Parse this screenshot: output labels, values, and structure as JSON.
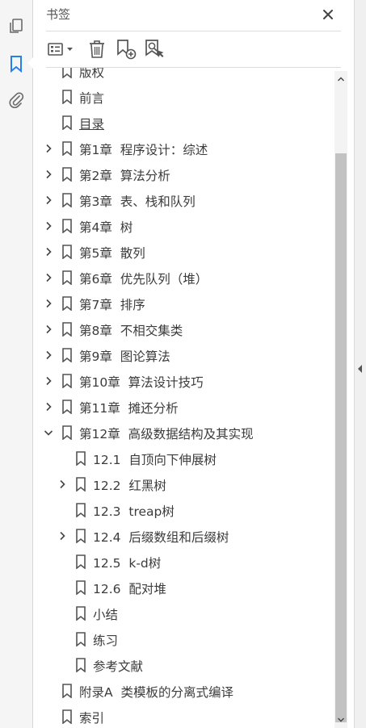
{
  "panel": {
    "title": "书签"
  },
  "rail": {
    "items": [
      "pages-icon",
      "bookmark-icon",
      "attachment-icon"
    ],
    "active": "bookmark-icon",
    "accent": "#2680eb"
  },
  "toolbar": {
    "icons": [
      "options-menu-icon",
      "delete-icon",
      "new-bookmark-icon",
      "find-bookmark-icon"
    ]
  },
  "bookmarks": [
    {
      "label": "版权",
      "level": 0,
      "expander": "none"
    },
    {
      "label": "前言",
      "level": 0,
      "expander": "none"
    },
    {
      "label": "目录",
      "level": 0,
      "expander": "none",
      "underline": true
    },
    {
      "label": "第1章  程序设计：综述",
      "level": 0,
      "expander": "collapsed"
    },
    {
      "label": "第2章  算法分析",
      "level": 0,
      "expander": "collapsed"
    },
    {
      "label": "第3章  表、栈和队列",
      "level": 0,
      "expander": "collapsed"
    },
    {
      "label": "第4章  树",
      "level": 0,
      "expander": "collapsed"
    },
    {
      "label": "第5章  散列",
      "level": 0,
      "expander": "collapsed"
    },
    {
      "label": "第6章  优先队列（堆）",
      "level": 0,
      "expander": "collapsed"
    },
    {
      "label": "第7章  排序",
      "level": 0,
      "expander": "collapsed"
    },
    {
      "label": "第8章  不相交集类",
      "level": 0,
      "expander": "collapsed"
    },
    {
      "label": "第9章  图论算法",
      "level": 0,
      "expander": "collapsed"
    },
    {
      "label": "第10章  算法设计技巧",
      "level": 0,
      "expander": "collapsed"
    },
    {
      "label": "第11章  摊还分析",
      "level": 0,
      "expander": "collapsed"
    },
    {
      "label": "第12章  高级数据结构及其实现",
      "level": 0,
      "expander": "expanded"
    },
    {
      "label": "12.1  自顶向下伸展树",
      "level": 1,
      "expander": "none"
    },
    {
      "label": "12.2  红黑树",
      "level": 1,
      "expander": "collapsed"
    },
    {
      "label": "12.3  treap树",
      "level": 1,
      "expander": "none"
    },
    {
      "label": "12.4  后缀数组和后缀树",
      "level": 1,
      "expander": "collapsed"
    },
    {
      "label": "12.5  k-d树",
      "level": 1,
      "expander": "none"
    },
    {
      "label": "12.6  配对堆",
      "level": 1,
      "expander": "none"
    },
    {
      "label": "小结",
      "level": 1,
      "expander": "none"
    },
    {
      "label": "练习",
      "level": 1,
      "expander": "none"
    },
    {
      "label": "参考文献",
      "level": 1,
      "expander": "none"
    },
    {
      "label": "附录A  类模板的分离式编译",
      "level": 0,
      "expander": "none"
    },
    {
      "label": "索引",
      "level": 0,
      "expander": "none"
    }
  ]
}
